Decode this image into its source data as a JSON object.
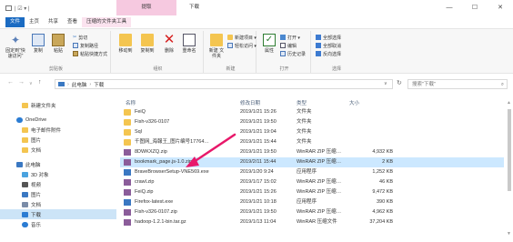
{
  "window": {
    "title": "下载",
    "context_tab": "提取",
    "quick_access": "| ☑ ▾ |",
    "minimize": "—",
    "maximize": "☐",
    "close": "✕"
  },
  "ribbon_tabs": [
    "文件",
    "主页",
    "共享",
    "查看",
    "压缩的文件夹工具"
  ],
  "ribbon": {
    "clipboard": {
      "name": "剪贴板",
      "pin": "固定到\"快速访问\"",
      "copy": "复制",
      "paste": "粘贴",
      "cut": "剪切",
      "copy_path": "复制路径",
      "paste_shortcut": "粘贴快捷方式"
    },
    "organize": {
      "name": "组织",
      "move_to": "移动到",
      "copy_to": "复制到",
      "delete": "删除",
      "rename": "重命名"
    },
    "new": {
      "name": "新建",
      "new_folder": "新建\n文件夹",
      "new_item": "新建项目 ▾",
      "easy_access": "轻松访问 ▾"
    },
    "open": {
      "name": "打开",
      "properties": "属性",
      "open": "打开 ▾",
      "edit": "编辑",
      "history": "历史记录"
    },
    "select": {
      "name": "选择",
      "select_all": "全部选择",
      "select_none": "全部取消",
      "invert": "反向选择"
    }
  },
  "address": {
    "back": "←",
    "forward": "→",
    "recent": "∨",
    "up": "↑",
    "path": [
      "此电脑",
      "下载"
    ],
    "dropdown": "∨",
    "refresh": "↻",
    "search_placeholder": "搜索\"下载\"",
    "search_icon": "⌕"
  },
  "nav_pane": [
    {
      "label": "新建文件夹",
      "icon": "folder-icon",
      "color": "#f4c550"
    },
    {
      "label": "OneDrive",
      "icon": "cloud-icon",
      "color": "#2b7cd3"
    },
    {
      "label": "电子邮件附件",
      "icon": "folder-icon",
      "color": "#f4c550"
    },
    {
      "label": "图片",
      "icon": "folder-icon",
      "color": "#f4c550"
    },
    {
      "label": "文档",
      "icon": "folder-icon",
      "color": "#f4c550"
    },
    {
      "label": "此电脑",
      "icon": "computer-icon",
      "color": "#3a78c2"
    },
    {
      "label": "3D 对象",
      "icon": "cube-icon",
      "color": "#4aa3df"
    },
    {
      "label": "视频",
      "icon": "video-icon",
      "color": "#555"
    },
    {
      "label": "图片",
      "icon": "image-icon",
      "color": "#3a78c2"
    },
    {
      "label": "文档",
      "icon": "document-icon",
      "color": "#7a8ca8"
    },
    {
      "label": "下载",
      "icon": "download-icon",
      "color": "#2b7cd3"
    },
    {
      "label": "音乐",
      "icon": "music-icon",
      "color": "#2b7cd3"
    }
  ],
  "file_list": {
    "headers": {
      "name": "名称",
      "date": "修改日期",
      "type": "类型",
      "size": "大小"
    },
    "rows": [
      {
        "name": "FeiQ",
        "date": "2019/1/21 15:26",
        "type": "文件夹",
        "size": "",
        "kind": "folder"
      },
      {
        "name": "Fish-v326-0107",
        "date": "2019/1/21 19:50",
        "type": "文件夹",
        "size": "",
        "kind": "folder"
      },
      {
        "name": "Sql",
        "date": "2019/1/21 19:04",
        "type": "文件夹",
        "size": "",
        "kind": "folder"
      },
      {
        "name": "千图网_海報王_图片编号17764…",
        "date": "2019/1/21 15:44",
        "type": "文件夹",
        "size": "",
        "kind": "folder"
      },
      {
        "name": "8DWKXZQ.zip",
        "date": "2019/1/21 19:50",
        "type": "WinRAR ZIP 压缩…",
        "size": "4,932 KB",
        "kind": "zip"
      },
      {
        "name": "bookmark_page.js-1.0.zip",
        "date": "2019/2/11 15:44",
        "type": "WinRAR ZIP 压缩…",
        "size": "2 KB",
        "kind": "zip",
        "selected": true
      },
      {
        "name": "BraveBrowserSetup-VNE569.exe",
        "date": "2019/1/20 9:24",
        "type": "应用程序",
        "size": "1,252 KB",
        "kind": "exe"
      },
      {
        "name": "crawl.zip",
        "date": "2019/1/17 15:02",
        "type": "WinRAR ZIP 压缩…",
        "size": "46 KB",
        "kind": "zip"
      },
      {
        "name": "FeiQ.zip",
        "date": "2019/1/21 15:26",
        "type": "WinRAR ZIP 压缩…",
        "size": "9,472 KB",
        "kind": "zip"
      },
      {
        "name": "Firefox-latest.exe",
        "date": "2019/1/21 10:18",
        "type": "应用程序",
        "size": "390 KB",
        "kind": "exe"
      },
      {
        "name": "Fish-v326-0107.zip",
        "date": "2019/1/21 19:50",
        "type": "WinRAR ZIP 压缩…",
        "size": "4,962 KB",
        "kind": "zip"
      },
      {
        "name": "hadoop-1.2.1-bin.tar.gz",
        "date": "2019/1/13 11:04",
        "type": "WinRAR 压缩文件",
        "size": "37,204 KB",
        "kind": "zip"
      }
    ]
  },
  "colors": {
    "accent": "#1b6bc2",
    "selection": "#cce8ff",
    "annotation_arrow": "#e8186a"
  }
}
